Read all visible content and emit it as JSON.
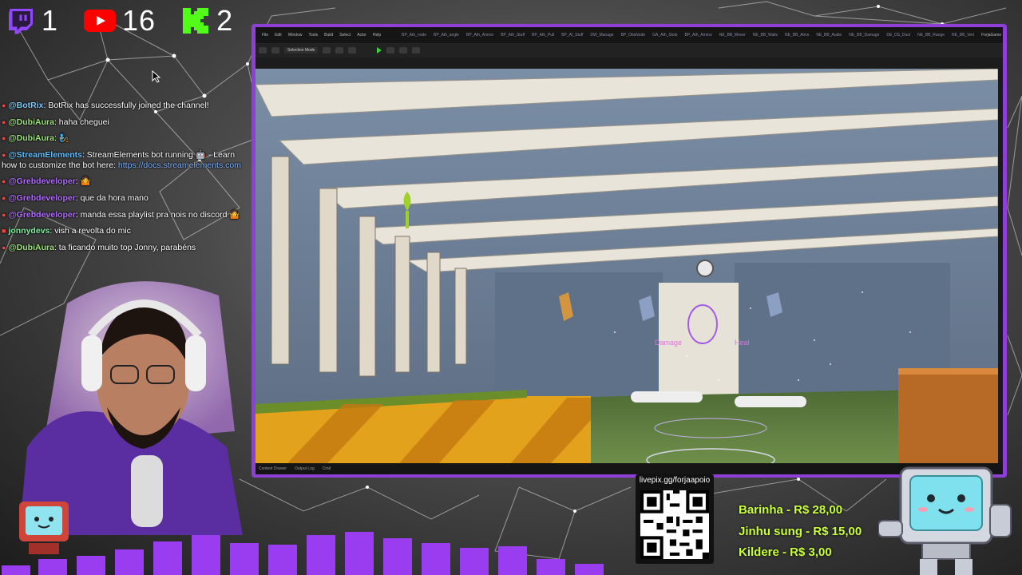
{
  "counters": {
    "twitch": "1",
    "youtube": "16",
    "kick": "2"
  },
  "chat": [
    {
      "user": "@BotRix",
      "text": ": BotRix has successfully joined the channel!",
      "color": "#7ec8ff"
    },
    {
      "user": "@DubiAura",
      "text": ": haha cheguei",
      "color": "#9be37a"
    },
    {
      "user": "@DubiAura",
      "text": ": 🧞",
      "color": "#9be37a"
    },
    {
      "user": "@StreamElements",
      "text": ": StreamElements bot running 🤖 - Learn how to customize the bot here: ",
      "link": "https://docs.streamelements.com",
      "color": "#5ec0ff"
    },
    {
      "user": "@Grebdeveloper",
      "text": ": 🤷",
      "color": "#b06cff"
    },
    {
      "user": "@Grebdeveloper",
      "text": ": que da hora mano",
      "color": "#b06cff"
    },
    {
      "user": "@Grebdeveloper",
      "text": ": manda essa playlist pra nois no discord 🤷",
      "color": "#b06cff"
    },
    {
      "user": "jonnydevs",
      "text": ": vish a revolta do mic",
      "color": "#7ef0a0"
    },
    {
      "user": "@DubiAura",
      "text": ": ta ficando muito top Jonny, parabéns",
      "color": "#9be37a"
    }
  ],
  "editor": {
    "menu": [
      "File",
      "Edit",
      "Window",
      "Tools",
      "Build",
      "Select",
      "Actor",
      "Help"
    ],
    "tabs": [
      "BP_Ath_node",
      "BP_Ath_angle",
      "BP_Ath_Ammo",
      "BP_Ath_Stuff",
      "BP_Ath_Pull",
      "BP_AI_Stuff",
      "DW_Manage",
      "BP_ObsNode",
      "GA_Ath_Slots",
      "BP_Ath_Ammo",
      "NE_BB_Mover",
      "NE_BB_Walls",
      "NE_BB_Aims",
      "NE_BB_Audio",
      "NE_BB_Damage",
      "DE_DS_Dust",
      "NE_BB_Range",
      "NE_BB_Vert"
    ],
    "project": "ForjaGame",
    "mode": "Selection Mode",
    "status": [
      "Content Drawer",
      "Output Log",
      "Cmd"
    ],
    "viewport_labels": {
      "left": "Damage",
      "right": "Heal"
    }
  },
  "donation": {
    "url": "livepix.gg/forjaapoio",
    "list": [
      "Barinha - R$ 28,00",
      "Jinhu sung - R$ 15,00",
      "Kildere - R$ 3,00"
    ]
  },
  "colors": {
    "frame": "#8d3fd6",
    "donation_text": "#c9ff3a",
    "equalizer": "#9a3cf0"
  }
}
